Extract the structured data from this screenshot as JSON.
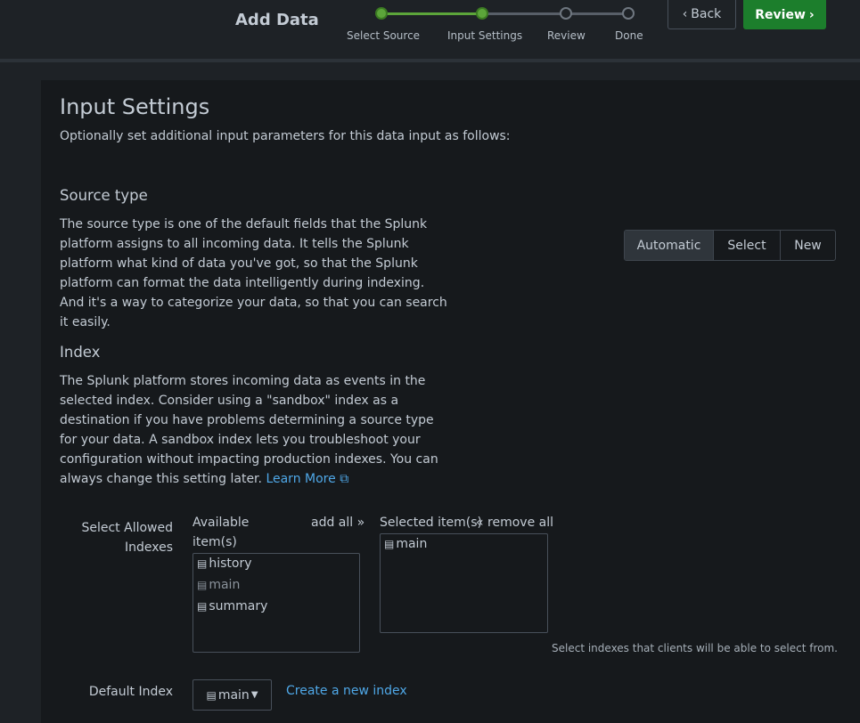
{
  "header": {
    "title": "Add Data",
    "steps": [
      {
        "label": "Select Source",
        "state": "done"
      },
      {
        "label": "Input Settings",
        "state": "done"
      },
      {
        "label": "Review",
        "state": "todo"
      },
      {
        "label": "Done",
        "state": "todo"
      }
    ],
    "back_label": "Back",
    "review_label": "Review"
  },
  "main": {
    "title": "Input Settings",
    "subtitle": "Optionally set additional input parameters for this data input as follows:",
    "source_type": {
      "heading": "Source type",
      "description": "The source type is one of the default fields that the Splunk platform assigns to all incoming data. It tells the Splunk platform what kind of data you've got, so that the Splunk platform can format the data intelligently during indexing. And it's a way to categorize your data, so that you can search it easily.",
      "options": [
        "Automatic",
        "Select",
        "New"
      ],
      "selected": "Automatic"
    },
    "index": {
      "heading": "Index",
      "description": "The Splunk platform stores incoming data as events in the selected index. Consider using a \"sandbox\" index as a destination if you have problems determining a source type for your data. A sandbox index lets you troubleshoot your configuration without impacting production indexes. You can always change this setting later.",
      "learn_more": "Learn More"
    },
    "allowed_indexes": {
      "label": "Select Allowed Indexes",
      "available_header": "Available item(s)",
      "add_all": "add all »",
      "selected_header": "Selected item(s)",
      "remove_all": "« remove all",
      "available": [
        "history",
        "main",
        "summary"
      ],
      "selected": [
        "main"
      ],
      "help": "Select indexes that clients will be able to select from."
    },
    "default_index": {
      "label": "Default Index",
      "value": "main",
      "create_link": "Create a new index"
    }
  },
  "colors": {
    "accent_green": "#1c7e2c",
    "progress_green": "#5ca53a",
    "link_blue": "#4fa8e8"
  }
}
